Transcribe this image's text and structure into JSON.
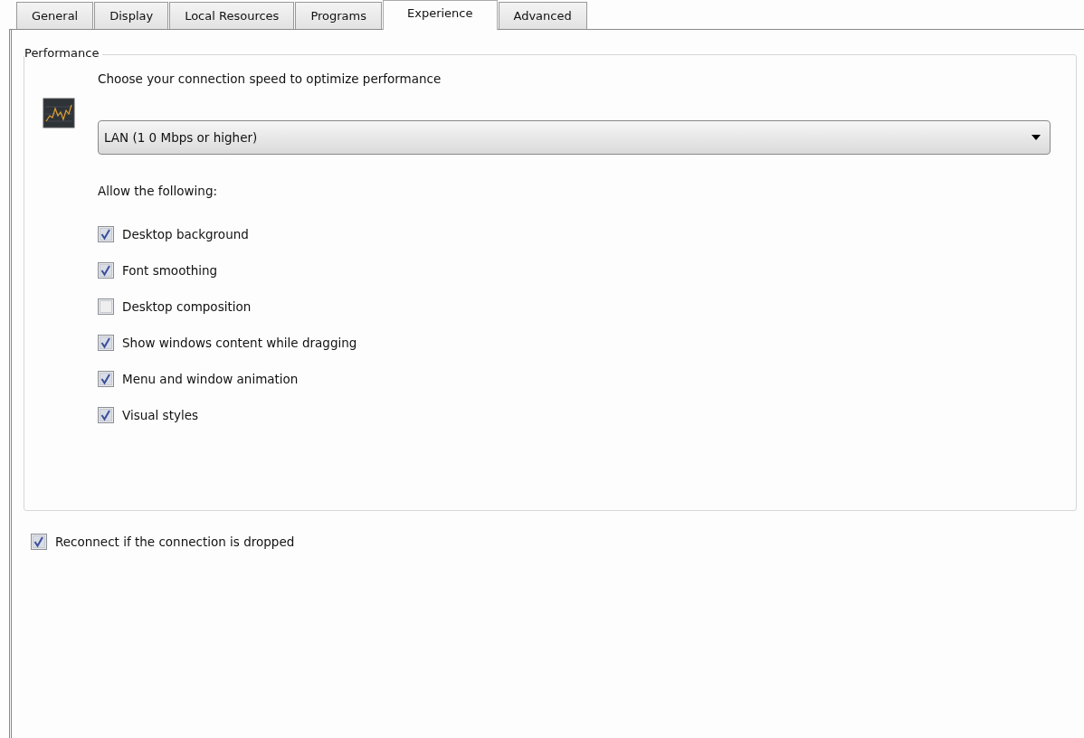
{
  "tabs": [
    {
      "label": "General",
      "selected": false
    },
    {
      "label": "Display",
      "selected": false
    },
    {
      "label": "Local Resources",
      "selected": false
    },
    {
      "label": "Programs",
      "selected": false
    },
    {
      "label": "Experience",
      "selected": true
    },
    {
      "label": "Advanced",
      "selected": false
    }
  ],
  "performance": {
    "title": "Performance",
    "prompt": "Choose your connection speed to optimize performance",
    "speed": {
      "value": "LAN (1 0 Mbps or higher)"
    },
    "allow_label": "Allow the following:",
    "options": [
      {
        "label": "Desktop background",
        "checked": true
      },
      {
        "label": "Font smoothing",
        "checked": true
      },
      {
        "label": "Desktop composition",
        "checked": false
      },
      {
        "label": "Show windows content while dragging",
        "checked": true
      },
      {
        "label": "Menu and window animation",
        "checked": true
      },
      {
        "label": "Visual styles",
        "checked": true
      }
    ]
  },
  "reconnect": {
    "label": "Reconnect if the connection is dropped",
    "checked": true
  }
}
